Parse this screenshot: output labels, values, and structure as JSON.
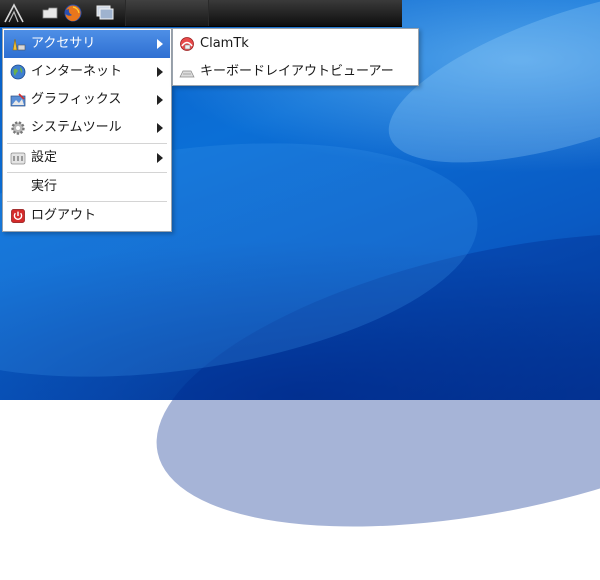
{
  "panel": {
    "launchers": [
      {
        "name": "lxde-menu-icon"
      },
      {
        "name": "file-manager-icon"
      },
      {
        "name": "firefox-icon"
      },
      {
        "name": "show-desktop-icon"
      }
    ]
  },
  "menu": {
    "items": [
      {
        "label": "アクセサリ",
        "icon": "accessories-icon",
        "submenu": true
      },
      {
        "label": "インターネット",
        "icon": "internet-icon",
        "submenu": true
      },
      {
        "label": "グラフィックス",
        "icon": "graphics-icon",
        "submenu": true
      },
      {
        "label": "システムツール",
        "icon": "system-tools-icon",
        "submenu": true
      },
      {
        "label": "設定",
        "icon": "preferences-icon",
        "submenu": true
      },
      {
        "label": "実行",
        "icon": "",
        "submenu": false
      },
      {
        "label": "ログアウト",
        "icon": "logout-icon",
        "submenu": false
      }
    ]
  },
  "submenu": {
    "items": [
      {
        "label": "ClamTk",
        "icon": "clamtk-icon"
      },
      {
        "label": "キーボードレイアウトビューアー",
        "icon": "keyboard-icon"
      }
    ]
  },
  "colors": {
    "active": "#3a7fde",
    "panel": "#1a1a1a",
    "desktop": "#0b6fd6"
  }
}
